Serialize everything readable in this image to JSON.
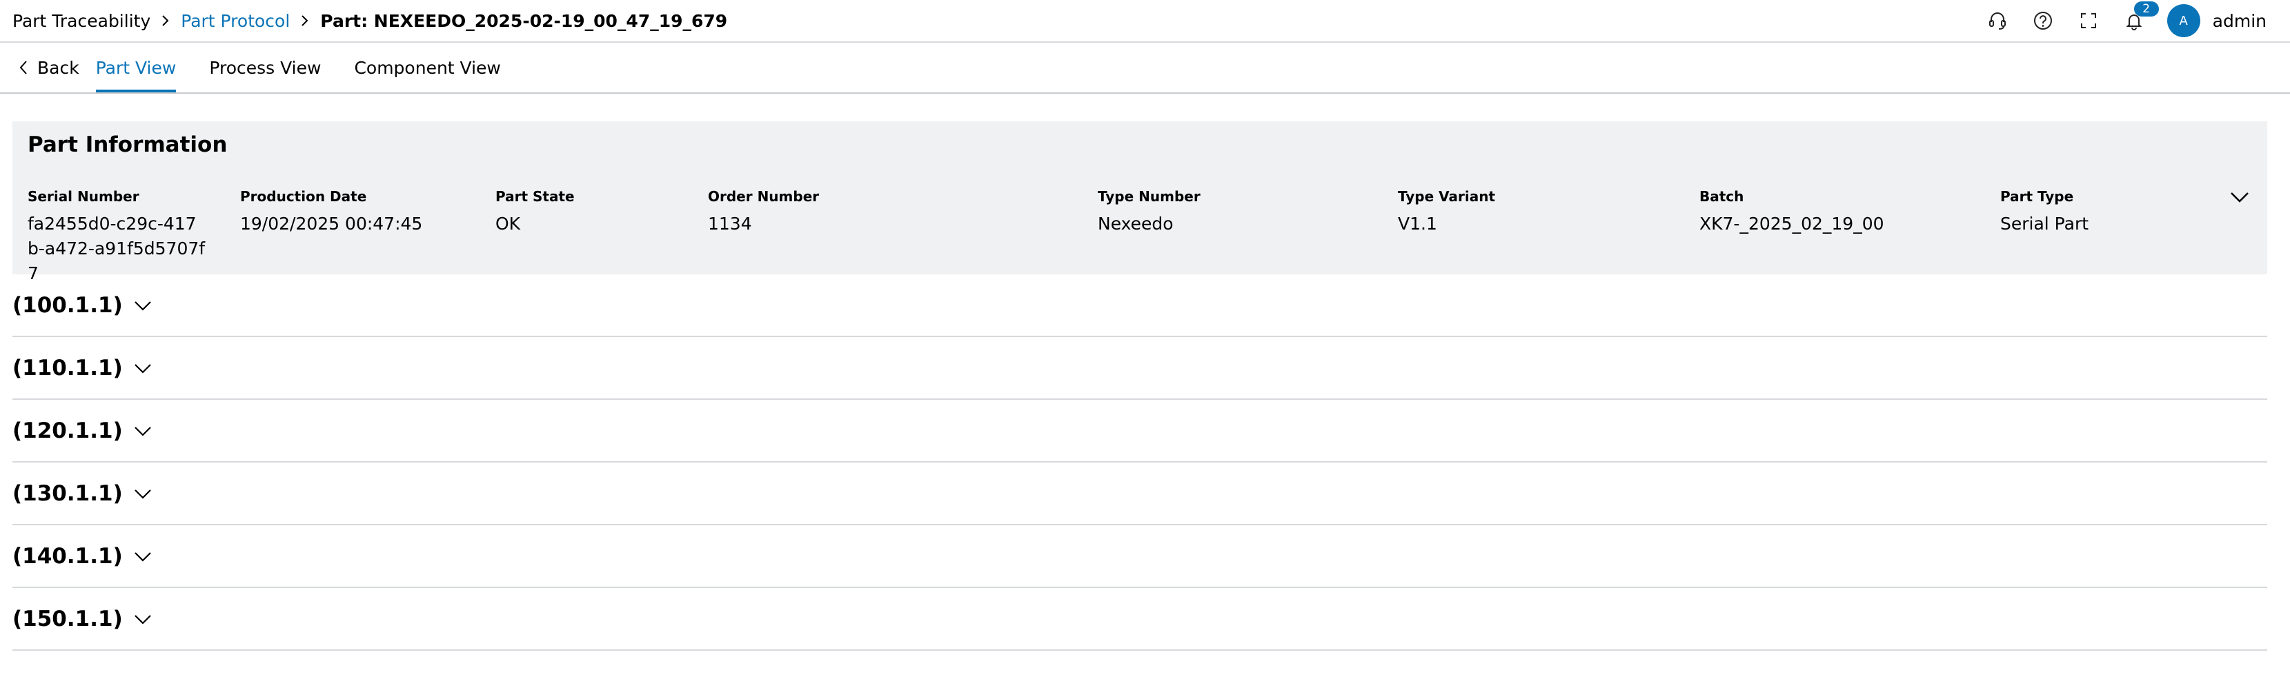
{
  "breadcrumb": {
    "items": [
      "Part Traceability",
      "Part Protocol",
      "Part: NEXEEDO_2025-02-19_00_47_19_679"
    ]
  },
  "header": {
    "notification_count": "2",
    "avatar_initial": "A",
    "user_name": "admin"
  },
  "nav": {
    "back_label": "Back",
    "tabs": [
      "Part View",
      "Process View",
      "Component View"
    ],
    "active_tab": "Part View"
  },
  "part_info": {
    "title": "Part Information",
    "fields": [
      {
        "label": "Serial Number",
        "value": "fa2455d0-c29c-417b-a472-a91f5d5707f7"
      },
      {
        "label": "Production Date",
        "value": "19/02/2025 00:47:45"
      },
      {
        "label": "Part State",
        "value": "OK"
      },
      {
        "label": "Order Number",
        "value": "1134"
      },
      {
        "label": "Type Number",
        "value": "Nexeedo"
      },
      {
        "label": "Type Variant",
        "value": "V1.1"
      },
      {
        "label": "Batch",
        "value": "XK7-_2025_02_19_00"
      },
      {
        "label": "Part Type",
        "value": "Serial Part"
      }
    ]
  },
  "sections": [
    "(100.1.1)",
    "(110.1.1)",
    "(120.1.1)",
    "(130.1.1)",
    "(140.1.1)",
    "(150.1.1)"
  ],
  "colors": {
    "accent": "#0a74b8",
    "card_background": "#eff1f2"
  }
}
